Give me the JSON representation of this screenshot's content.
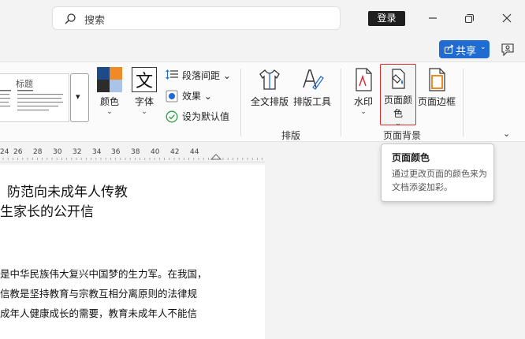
{
  "titlebar": {
    "search_placeholder": "搜索",
    "login_label": "登录",
    "minimize_icon": "minimize-icon",
    "maximize_icon": "restore-icon",
    "close_icon": "close-icon"
  },
  "share": {
    "label": "共享",
    "icon": "share-icon"
  },
  "feedback_icon": "feedback-icon",
  "ribbon": {
    "style_gallery": {
      "sample_label": "标题"
    },
    "colors": {
      "label": "颜色"
    },
    "fonts": {
      "label": "字体"
    },
    "paragraph_spacing": {
      "label": "段落间距"
    },
    "effects": {
      "label": "效果"
    },
    "set_default": {
      "label": "设为默认值"
    },
    "fulltext_layout": {
      "label": "全文排版"
    },
    "layout_tools": {
      "label": "排版工具"
    },
    "watermark": {
      "label": "水印"
    },
    "page_color": {
      "label_line1": "页面颜",
      "label_line2": "色"
    },
    "page_border": {
      "label": "页面边框"
    },
    "groups": {
      "layout": "排版",
      "page_background": "页面背景"
    }
  },
  "ruler": {
    "ticks": [
      "24",
      "26",
      "28",
      "30",
      "32",
      "34",
      "36",
      "38",
      "40",
      "42",
      "44"
    ]
  },
  "document": {
    "title_line1": "防范向未成年人传教",
    "title_line2": "生家长的公开信",
    "paragraphs": [
      "是中华民族伟大复兴中国梦的生力军。在我国，",
      "信教是坚持教育与宗教互相分离原则的法律规",
      "成年人健康成长的需要，教育未成年人不能信"
    ]
  },
  "tooltip": {
    "title": "页面颜色",
    "description": "通过更改页面的颜色来为文档添姿加彩。"
  },
  "colors": {
    "accent": "#1f6bd1",
    "highlight_border": "#e0282e",
    "check_green": "#2e9e44"
  }
}
